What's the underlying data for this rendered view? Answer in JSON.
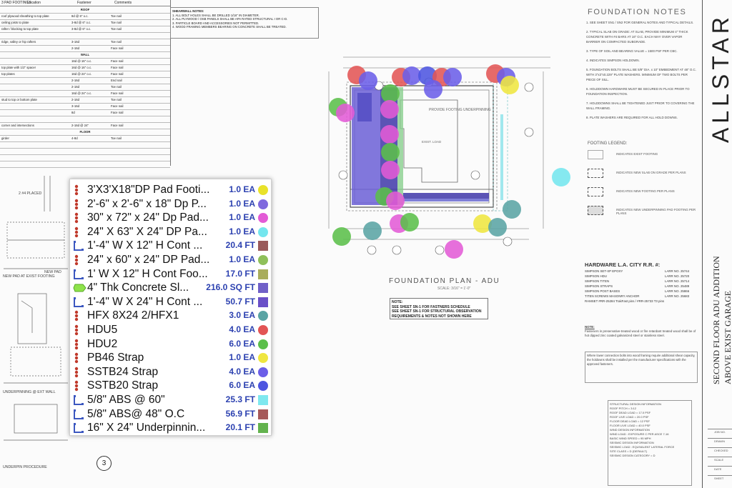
{
  "schedule": {
    "header": [
      "3  PAD FOOTINGS",
      "Location",
      "Fastener",
      "Comments"
    ],
    "rows": [
      {
        "kind": "sec",
        "text": "ROOF"
      },
      {
        "a": "roof plywood sheathing to top plate",
        "b": "8d @ 6\" o.c.",
        "c": "Toe nail"
      },
      {
        "a": "ceiling joists to plate",
        "b": "3-8d @ 6\" o.c.",
        "c": "Toe nail"
      },
      {
        "a": "rafter / blocking to top plate",
        "b": "3-8d @ 6\" o.c.",
        "c": "Toe nail"
      },
      {
        "a": "",
        "b": "",
        "c": ""
      },
      {
        "a": "ridge, valley or hip rafters",
        "b": "3-16d",
        "c": "Toe nail"
      },
      {
        "a": "",
        "b": "2-16d",
        "c": "Face nail"
      },
      {
        "kind": "sec",
        "text": "WALL"
      },
      {
        "a": "",
        "b": "16d @ 16\" o.c.",
        "c": "Face nail"
      },
      {
        "a": "top plate with 1/2\" spacer",
        "b": "16d @ 16\" o.c.",
        "c": "Face nail"
      },
      {
        "a": "top plates",
        "b": "16d @ 24\" o.c.",
        "c": "Face nail"
      },
      {
        "a": "",
        "b": "2-16d",
        "c": "End nail"
      },
      {
        "a": "",
        "b": "2-16d",
        "c": "Toe nail"
      },
      {
        "a": "",
        "b": "16d @ 24\" o.c.",
        "c": "Face nail"
      },
      {
        "a": "stud to top or bottom plate",
        "b": "2-16d",
        "c": "Toe nail"
      },
      {
        "a": "",
        "b": "3-16d",
        "c": "Face nail"
      },
      {
        "a": "",
        "b": "8d",
        "c": "Face nail"
      },
      {
        "a": "",
        "b": "",
        "c": ""
      },
      {
        "a": "corner and intersections",
        "b": "2-16d @ 24\"",
        "c": "Face nail"
      },
      {
        "kind": "sec",
        "text": "FLOOR"
      },
      {
        "a": "girder",
        "b": "4-8d",
        "c": "Toe nail"
      },
      {
        "a": "",
        "b": "",
        "c": ""
      },
      {
        "a": "",
        "b": "",
        "c": ""
      },
      {
        "a": "",
        "b": "",
        "c": ""
      },
      {
        "a": "",
        "b": "",
        "c": ""
      }
    ]
  },
  "general_notes": {
    "title": "SHEARWALL NOTES:",
    "lines": [
      "1. ALL BOLT HOLES SHALL BE DRILLED 1/16\" IN DIAMETER.",
      "2. ALL PLYWOOD / OSB PANELS SHALL BE APA RATED STRUCTURAL I OR C-D.",
      "3. PARTICLE BOARD AND ACCESSORIES NOT PERMITTED.",
      "4. WOOD FRAMING MEMBERS BEARING ON CONCRETE SHALL BE TREATED."
    ]
  },
  "legend": {
    "items": [
      {
        "icon": "dot-column-icon",
        "name": "3'X3'X18\"DP Pad Footi...",
        "qty": "1.0 EA",
        "swatch": "dot",
        "color": "#e9e22a"
      },
      {
        "icon": "dot-column-icon",
        "name": "2'-6\" x 2'-6\" x 18\" Dp P...",
        "qty": "1.0 EA",
        "swatch": "dot",
        "color": "#7f69de"
      },
      {
        "icon": "dot-column-icon",
        "name": "30\" x 72\" x 24\" Dp Pad...",
        "qty": "1.0 EA",
        "swatch": "dot",
        "color": "#e35bd6"
      },
      {
        "icon": "dot-column-icon",
        "name": "24\" X 63\" X 24\" DP Pa...",
        "qty": "1.0 EA",
        "swatch": "dot",
        "color": "#74e6ee"
      },
      {
        "icon": "linear-measure-icon",
        "name": "1'-4\" W X 12\" H Cont ...",
        "qty": "20.4 FT",
        "swatch": "square",
        "color": "#9a5a5a"
      },
      {
        "icon": "dot-column-icon",
        "name": "24\" x 60\" x 24\" DP Pad...",
        "qty": "1.0 EA",
        "swatch": "dot",
        "color": "#8fc05a"
      },
      {
        "icon": "linear-measure-icon",
        "name": "1' W X 12\" H Cont Foo...",
        "qty": "17.0 FT",
        "swatch": "square",
        "color": "#a9ad5c"
      },
      {
        "icon": "area-polygon-icon",
        "name": "4\" Thk Concrete Sl...",
        "qty": "216.0 SQ FT",
        "swatch": "square",
        "color": "#7060c8"
      },
      {
        "icon": "linear-measure-icon",
        "name": "1'-4\" W X 24\" H Cont ...",
        "qty": "50.7 FT",
        "swatch": "square",
        "color": "#6a50c8"
      },
      {
        "icon": "dot-column-icon",
        "name": "HFX 8X24 2/HFX1",
        "qty": "3.0 EA",
        "swatch": "dot",
        "color": "#5aa4a4"
      },
      {
        "icon": "dot-column-icon",
        "name": "HDU5",
        "qty": "4.0 EA",
        "swatch": "dot",
        "color": "#e25555"
      },
      {
        "icon": "dot-column-icon",
        "name": "HDU2",
        "qty": "6.0 EA",
        "swatch": "dot",
        "color": "#5bbf4a"
      },
      {
        "icon": "dot-column-icon",
        "name": "PB46 Strap",
        "qty": "1.0 EA",
        "swatch": "dot",
        "color": "#efe640"
      },
      {
        "icon": "dot-column-icon",
        "name": "SSTB24 Strap",
        "qty": "4.0 EA",
        "swatch": "dot",
        "color": "#6b5ee8"
      },
      {
        "icon": "dot-column-icon",
        "name": "SSTB20 Strap",
        "qty": "6.0 EA",
        "swatch": "dot",
        "color": "#4d55e0"
      },
      {
        "icon": "linear-measure-icon",
        "name": "5/8\" ABS @ 60\"",
        "qty": "25.3 FT",
        "swatch": "square",
        "color": "#7fe8ef"
      },
      {
        "icon": "linear-measure-icon",
        "name": "5/8\" ABS@ 48\" O.C",
        "qty": "56.9 FT",
        "swatch": "square",
        "color": "#a65a5a"
      },
      {
        "icon": "linear-measure-icon",
        "name": "16\" X 24\" Underpinnin...",
        "qty": "20.1 FT",
        "swatch": "square",
        "color": "#63b34e"
      }
    ]
  },
  "page_number": "3",
  "plan": {
    "title": "FOUNDATION PLAN - ADU",
    "scale": "SCALE: 3/16\" = 1'-0\"",
    "note_title": "NOTE:",
    "note_lines": [
      "SEE SHEET SN-1 FOR FASTNERS SCHEDULE",
      "SEE SHEET SN-1 FOR STRUCTURAL OBSERVATION",
      "REQUIREMENTS & NOTES NOT SHOWN HERE"
    ],
    "room_label": "PROVIDE FOOTING UNDERPINNING",
    "exist_label": "EXIST. LOAD"
  },
  "foundation_notes": {
    "title": "FOUNDATION NOTES",
    "paras": [
      "1. SEE SHEET SN1 / SN2 FOR GENERAL NOTES AND TYPICAL DETAILS.",
      "2. TYPICAL SLAB ON GRADE: AT SLAB, PROVIDE MINIMUM 4\" THICK CONCRETE WITH #4 BARS AT 16\" O.C. EACH WAY OVER VAPOR BARRIER ON COMPACTED SUBGRADE.",
      "3. TYPE OF SOIL AND BEARING VALUE = 1500 PSF PER CBC.",
      "4. INDICATES SIMPSON HOLDOWN.",
      "5. FOUNDATION BOLTS SHALL BE 5/8\" DIA. x 10\" EMBEDMENT AT 48\" O.C. WITH 3\"x3\"x0.229\" PLATE WASHERS. MINIMUM OF TWO BOLTS PER PIECE OF SILL.",
      "6. HOLDDOWN HARDWARE MUST BE SECURED IN PLACE PRIOR TO FOUNDATION INSPECTION.",
      "7. HOLDDOWNS SHALL BE TIGHTENED JUST PRIOR TO COVERING THE WALL FRAMING.",
      "8. PLATE WASHERS ARE REQUIRED FOR ALL HOLD DOWNS."
    ],
    "footing_legend_title": "FOOTING LEGEND:",
    "footing_legend": [
      "INDICATES EXIST FOOTING",
      "INDICATES NEW SLAB ON GRADE PER PLANS",
      "INDICATES NEW FOOTING PER PLANS",
      "INDICATES NEW UNDERPINNING PAD FOOTING PER PLANS"
    ]
  },
  "hardware": {
    "title": "HARDWARE L.A. CITY R.R. #:",
    "rows": [
      {
        "name": "SIMPSON SET-XP EPOXY",
        "rr": "LARR NO. 25744"
      },
      {
        "name": "SIMPSON HDU",
        "rr": "LARR NO. 25720"
      },
      {
        "name": "SIMPSON TITEN",
        "rr": "LARR NO. 25714"
      },
      {
        "name": "SIMPSON STRAPS",
        "rr": "LARR NO. 25489"
      },
      {
        "name": "SIMPSON POST BASES",
        "rr": "LARR NO. 25866"
      },
      {
        "name": "TITEN SCREWS MASONRY ANCHOR",
        "rr": "LARR NO. 25683"
      },
      {
        "name": "RAMSET #RR-25284 TrakFast pins / #RR-25733 T3 pins",
        "rr": ""
      }
    ],
    "note_title": "NOTE:",
    "note_text": "Fasteners in preservative-treated wood or fire retardant treated wood shall be of hot dipped zinc coated galvanized steel or stainless steel.",
    "note_box": "Where lower connection bolts into wood framing require additional shear capacity, the holdowns shall be installed per the manufacturer specifications with the approved fasteners."
  },
  "design_info": {
    "lines": [
      "STRUCTURAL DESIGN INFORMATION",
      "ROOF PITCH = 3:12",
      "ROOF DEAD LOAD = 17.0 PSF",
      "ROOF LIVE LOAD = 20.0 PSF",
      "FLOOR DEAD LOAD = 12 PSF",
      "FLOOR LIVE LOAD = 40.0 PSF",
      "WIND DESIGN INFORMATION",
      "WIND LOAD : EXPOSURE C PER ASCE 7-16",
      "BASIC WIND SPEED = 95 MPH",
      "SEISMIC DESIGN INFORMATION",
      "SEISMIC LOAD : EQUIVALENT LATERAL FORCE",
      "SITE CLASS = D (DEFAULT)",
      "SEISMIC DESIGN CATEGORY = D"
    ]
  },
  "title_block": {
    "brand": "ALLSTAR",
    "project_line1": "SECOND FLOOR ADU ADDITION",
    "project_line2": "ABOVE EXIST GARAGE",
    "labels": [
      "JOB NO.",
      "DRAWN",
      "CHECKED",
      "SCALE",
      "DATE",
      "SHEET"
    ]
  },
  "details": {
    "exist_footing": "NEW PAD AT EXIST FOOTING",
    "underpinning": "UNDERPINNING @ EXT WALL",
    "procedure": "UNDERPIN PROCEDURE",
    "pad_placed": "2 #4 PLACED",
    "new_pad": "NEW PAD"
  }
}
